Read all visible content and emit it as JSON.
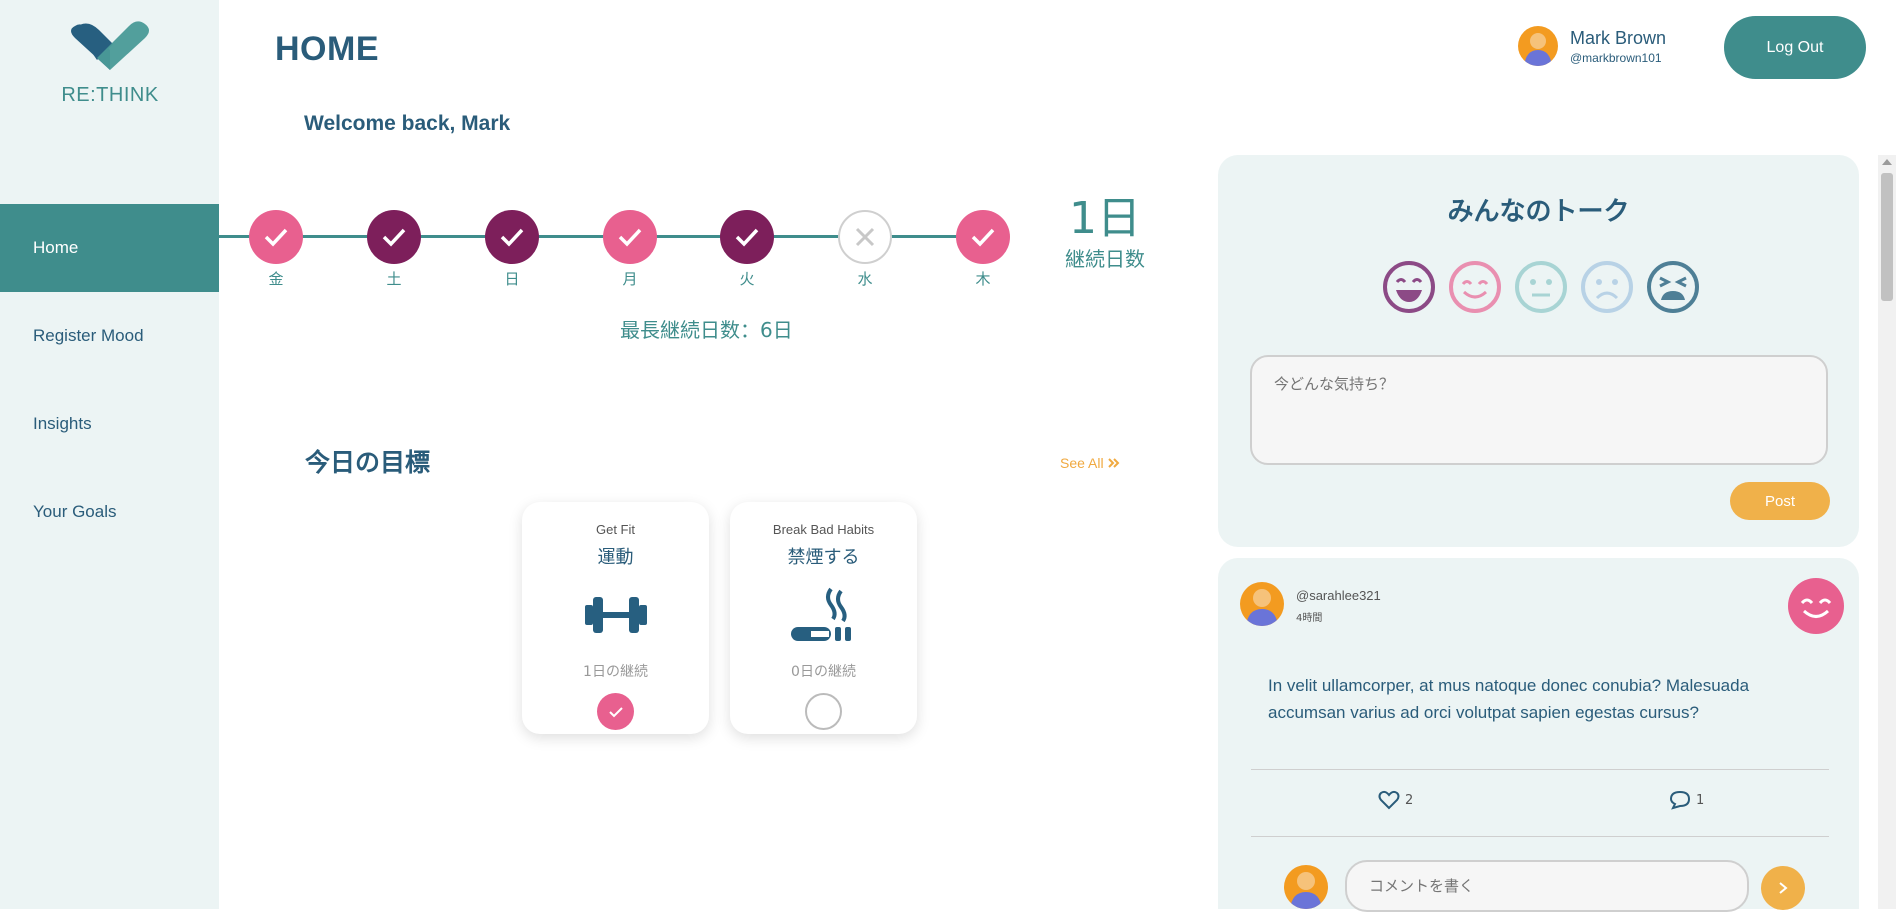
{
  "app": {
    "logo_text": "RE:THINK"
  },
  "sidebar": {
    "items": [
      {
        "label": "Home",
        "active": true
      },
      {
        "label": "Register Mood",
        "active": false
      },
      {
        "label": "Insights",
        "active": false
      },
      {
        "label": "Your Goals",
        "active": false
      }
    ]
  },
  "header": {
    "title": "HOME",
    "welcome": "Welcome back, Mark",
    "user_name": "Mark Brown",
    "user_handle": "@markbrown101",
    "logout_label": "Log Out"
  },
  "streak": {
    "days": [
      {
        "label": "金",
        "status": "done",
        "color": "#e8608f"
      },
      {
        "label": "土",
        "status": "done",
        "color": "#7d1f5b"
      },
      {
        "label": "日",
        "status": "done",
        "color": "#7d1f5b"
      },
      {
        "label": "月",
        "status": "done",
        "color": "#e8608f"
      },
      {
        "label": "火",
        "status": "done",
        "color": "#7d1f5b"
      },
      {
        "label": "水",
        "status": "missed",
        "color": "#ffffff"
      },
      {
        "label": "木",
        "status": "done",
        "color": "#e8608f"
      }
    ],
    "count": "1日",
    "count_label": "継続日数",
    "longest": "最長継続日数：6日"
  },
  "goals": {
    "title": "今日の目標",
    "see_all": "See All",
    "cards": [
      {
        "category": "Get Fit",
        "name": "運動",
        "icon": "dumbbell-icon",
        "streak": "1日の継続",
        "done": true
      },
      {
        "category": "Break Bad Habits",
        "name": "禁煙する",
        "icon": "no-smoking-icon",
        "streak": "0日の継続",
        "done": false
      }
    ]
  },
  "talk": {
    "title": "みんなのトーク",
    "moods": [
      "very-happy-face-icon",
      "happy-face-icon",
      "neutral-face-icon",
      "sad-face-icon",
      "very-sad-face-icon"
    ],
    "input_placeholder": "今どんな気持ち？",
    "post_label": "Post"
  },
  "post": {
    "handle": "@sarahlee321",
    "time": "4時間",
    "body": "In velit ullamcorper, at mus natoque donec conubia? Malesuada accumsan varius ad orci volutpat sapien egestas cursus?",
    "likes": "2",
    "comments": "1",
    "comment_placeholder": "コメントを書く"
  },
  "colors": {
    "teal": "#3f8d8c",
    "navy": "#2a5c7a",
    "pink": "#e8608f",
    "purple": "#7d1f5b",
    "orange": "#f0b14a",
    "panel": "#ecf4f4"
  }
}
